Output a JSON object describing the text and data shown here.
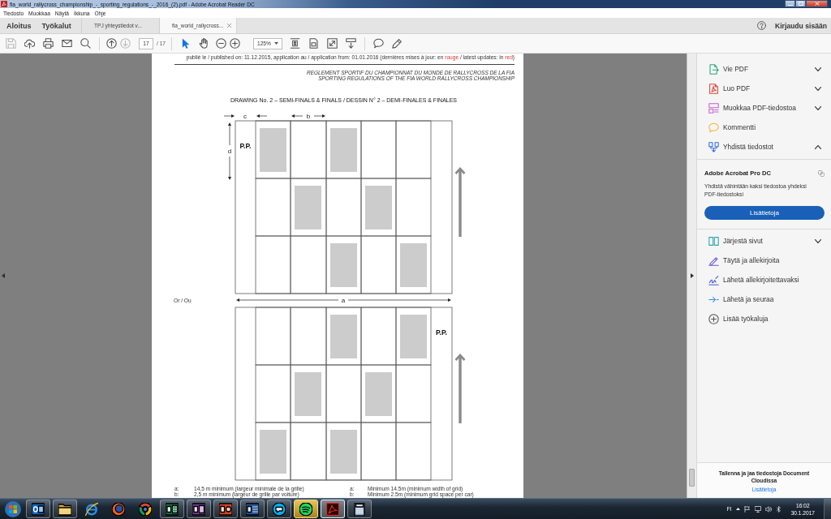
{
  "window": {
    "title": "fia_world_rallycross_championship_-_sporting_regulations_-_2016_(2).pdf - Adobe Acrobat Reader DC"
  },
  "menu": [
    "Tiedosto",
    "Muokkaa",
    "Näytä",
    "Ikkuna",
    "Ohje"
  ],
  "nav": [
    "Aloitus",
    "Työkalut"
  ],
  "tabs": [
    {
      "label": "TPJ yhteystiedot v...",
      "selected": false
    },
    {
      "label": "fia_world_rallycross...",
      "selected": true
    }
  ],
  "sign_in": "Kirjaudu sisään",
  "toolbar": {
    "groups": [
      {
        "buttons": [
          {
            "disabled": true,
            "selected": false
          },
          {
            "disabled": false,
            "selected": false
          },
          {
            "disabled": false,
            "selected": false
          },
          {
            "disabled": false,
            "selected": false
          },
          {
            "disabled": false,
            "selected": false
          }
        ]
      },
      {
        "buttons": [
          {
            "disabled": false,
            "selected": false
          },
          {
            "disabled": true,
            "selected": false
          }
        ],
        "page_field": {
          "value": "17"
        },
        "page_count": "/ 17"
      },
      {
        "buttons": [
          {
            "disabled": false,
            "selected": true
          },
          {
            "disabled": false,
            "selected": false
          },
          {
            "disabled": false,
            "selected": false
          },
          {
            "disabled": false,
            "selected": false
          }
        ],
        "zoom_field": {
          "value": "125%"
        },
        "view_buttons": [
          {
            "disabled": false,
            "selected": false
          },
          {
            "disabled": false,
            "selected": false
          },
          {
            "disabled": false,
            "selected": false
          },
          {
            "disabled": false,
            "selected": false
          }
        ]
      },
      {
        "buttons": [
          {
            "disabled": false,
            "selected": false
          },
          {
            "disabled": false,
            "selected": false
          }
        ]
      }
    ]
  },
  "document": {
    "header": [
      {
        "text": "publié le / published on: 11.12.2015, application au / application from: 01.01.2016 (dernières mises à jour: en ",
        "highlight": false
      },
      {
        "text": "rouge",
        "highlight": true
      },
      {
        "text": " / latest updates: in ",
        "highlight": false
      },
      {
        "text": "red",
        "highlight": true
      },
      {
        "text": ")",
        "highlight": false
      }
    ],
    "running_title": [
      "REGLEMENT SPORTIF DU CHAMPIONNAT DU MONDE DE RALLYCROSS DE LA FIA",
      "SPORTING REGULATIONS OF THE FIA WORLD RALLYCROSS CHAMPIONSHIP"
    ],
    "drawing": {
      "title": "DRAWING No. 2 – SEMI-FINALS & FINALS / DESSIN N° 2 – DEMI-FINALES & FINALES",
      "dimension_labels": [
        "c",
        "b",
        "d"
      ],
      "alternative_label": "Or / Ou",
      "width_label": "a",
      "grids": [
        {
          "pole_label": "P.P.",
          "pole_left": true,
          "rows": [
            [
              {
                "occupied": true
              },
              {
                "occupied": false
              },
              {
                "occupied": true
              },
              {
                "occupied": false
              },
              {
                "occupied": false
              }
            ],
            [
              {
                "occupied": false
              },
              {
                "occupied": true
              },
              {
                "occupied": false
              },
              {
                "occupied": true
              },
              {
                "occupied": false
              }
            ],
            [
              {
                "occupied": false
              },
              {
                "occupied": false
              },
              {
                "occupied": true
              },
              {
                "occupied": false
              },
              {
                "occupied": true
              }
            ]
          ]
        },
        {
          "pole_label": "P.P.",
          "pole_left": false,
          "rows": [
            [
              {
                "occupied": false
              },
              {
                "occupied": false
              },
              {
                "occupied": true
              },
              {
                "occupied": false
              },
              {
                "occupied": true
              }
            ],
            [
              {
                "occupied": false
              },
              {
                "occupied": true
              },
              {
                "occupied": false
              },
              {
                "occupied": true
              },
              {
                "occupied": false
              }
            ],
            [
              {
                "occupied": true
              },
              {
                "occupied": false
              },
              {
                "occupied": true
              },
              {
                "occupied": false
              },
              {
                "occupied": false
              }
            ]
          ]
        }
      ]
    },
    "legend": {
      "french": [
        {
          "key": "a:",
          "text": "14,5 m minimum (largeur minimale de la grille)"
        },
        {
          "key": "b:",
          "text": "2,5 m minimum (largeur de grille par voiture)"
        }
      ],
      "english": [
        {
          "key": "a:",
          "text": "Minimum 14.5m (minimum width of grid)"
        },
        {
          "key": "b:",
          "text": "Minimum 2.5m (minimum grid space per car)"
        }
      ]
    }
  },
  "right_panel": {
    "tools": [
      {
        "label": "Vie PDF",
        "expanded": false
      },
      {
        "label": "Luo PDF",
        "expanded": false
      },
      {
        "label": "Muokkaa PDF-tiedostoa",
        "expanded": false
      },
      {
        "label": "Kommentti"
      },
      {
        "label": "Yhdistä tiedostot",
        "expanded": true,
        "detail": {
          "title": "Adobe Acrobat Pro DC",
          "description": "Yhdistä vähintään kaksi tiedostoa yhdeksi PDF-tiedostoksi",
          "button": "Lisätietoja"
        }
      },
      {
        "label": "Järjestä sivut",
        "expanded": false
      },
      {
        "label": "Täytä ja allekirjoita"
      },
      {
        "label": "Lähetä allekirjoitettavaksi"
      },
      {
        "label": "Lähetä ja seuraa"
      },
      {
        "label": "Lisää työkaluja"
      }
    ],
    "footer": {
      "text": "Tallenna ja jaa tiedostoja Document Cloudissa",
      "link": "Lisätietoja"
    }
  },
  "taskbar": {
    "apps": [
      {
        "running": true,
        "selected": false,
        "hovered": false
      },
      {
        "running": true,
        "selected": false,
        "hovered": false
      },
      {
        "running": false,
        "selected": false,
        "hovered": false
      },
      {
        "running": false,
        "selected": false,
        "hovered": false
      },
      {
        "running": false,
        "selected": false,
        "hovered": false
      },
      {
        "running": true,
        "selected": false,
        "hovered": false
      },
      {
        "running": true,
        "selected": false,
        "hovered": false
      },
      {
        "running": true,
        "selected": false,
        "hovered": false
      },
      {
        "running": true,
        "selected": false,
        "hovered": false
      },
      {
        "running": true,
        "selected": false,
        "hovered": false
      },
      {
        "running": true,
        "selected": false,
        "hovered": true
      },
      {
        "running": true,
        "selected": true,
        "hovered": false
      },
      {
        "running": true,
        "selected": false,
        "hovered": false
      }
    ],
    "language": "FI",
    "time": "16:02",
    "date": "30.1.2017"
  }
}
